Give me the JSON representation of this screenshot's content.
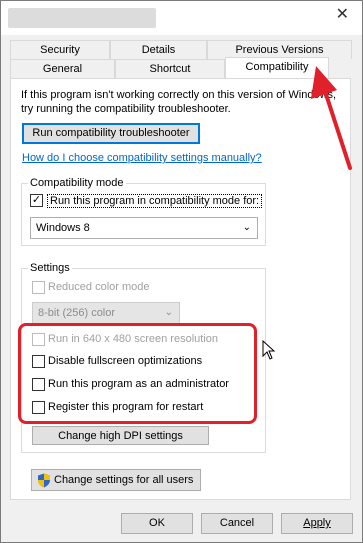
{
  "window": {
    "close_glyph": "✕"
  },
  "tabs": {
    "row1": [
      "Security",
      "Details",
      "Previous Versions"
    ],
    "row2": [
      "General",
      "Shortcut",
      "Compatibility"
    ],
    "active": "Compatibility"
  },
  "intro": {
    "line1": "If this program isn't working correctly on this version of Windows,",
    "line2": "try running the compatibility troubleshooter."
  },
  "troubleshooter_button": "Run compatibility troubleshooter",
  "manual_link": "How do I choose compatibility settings manually?",
  "compat_mode": {
    "label": "Compatibility mode",
    "checkbox_label": "Run this program in compatibility mode for:",
    "checked": true,
    "selected_os": "Windows 8"
  },
  "settings": {
    "label": "Settings",
    "reduced_color": "Reduced color mode",
    "color_value": "8-bit (256) color",
    "run_640": "Run in 640 x 480 screen resolution",
    "disable_fullscreen": "Disable fullscreen optimizations",
    "run_admin": "Run this program as an administrator",
    "register_restart": "Register this program for restart",
    "dpi_button": "Change high DPI settings"
  },
  "all_users_button": "Change settings for all users",
  "footer": {
    "ok": "OK",
    "cancel": "Cancel",
    "apply": "Apply"
  },
  "colors": {
    "highlight": "#e0202a",
    "link": "#0066cc",
    "focus": "#0078d7"
  }
}
